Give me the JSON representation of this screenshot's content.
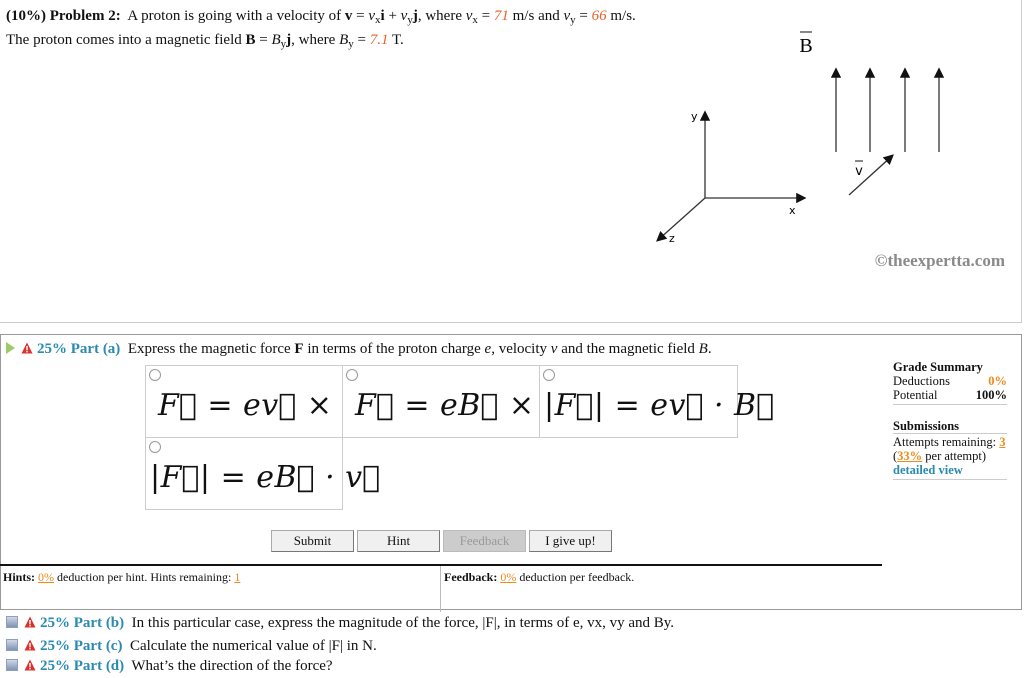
{
  "problem": {
    "weight": "(10%)",
    "title": "Problem 2:",
    "text_1": "A proton is going with a velocity of ",
    "v_bold": "v",
    "eq_1": " = ",
    "vx": "v",
    "x_sub": "x",
    "i": "i",
    "plus": " + ",
    "vy": "v",
    "y_sub": "y",
    "j": "j",
    "where_1": ", where ",
    "vx_val": "71",
    "units_1": " m/s and ",
    "vy_val": "66",
    "text_2": " m/s. The proton comes into a magnetic field ",
    "B_bold": "B",
    "By": "B",
    "where_2": ", where ",
    "By_val": "7.1",
    "units_2": " T."
  },
  "figure": {
    "B_label": "B",
    "v_label": "v",
    "axis_x": "x",
    "axis_y": "y",
    "axis_z": "z",
    "watermark": "©theexpertta.com"
  },
  "part_a": {
    "weight": "25%",
    "label": "Part (a)",
    "question_1": "Express the magnetic force ",
    "F": "F",
    "question_2": " in terms of the proton charge ",
    "e": "e",
    "question_3": ", velocity ",
    "v": "v",
    "question_4": " and the magnetic field ",
    "B": "B",
    "question_5": ".",
    "choices": [
      "F⃗ = ev⃗ × B⃗",
      "F⃗ = eB⃗ × v⃗",
      "|F⃗| = ev⃗ · B⃗",
      "|F⃗| = eB⃗ · v⃗"
    ]
  },
  "buttons": {
    "submit": "Submit",
    "hint": "Hint",
    "feedback": "Feedback",
    "give_up": "I give up!"
  },
  "grade_summary": {
    "title": "Grade Summary",
    "deductions_label": "Deductions",
    "deductions_value": "0%",
    "potential_label": "Potential",
    "potential_value": "100%",
    "submissions_title": "Submissions",
    "attempts_label": "Attempts remaining: ",
    "attempts_value": "3",
    "per_attempt_open": "(",
    "per_attempt_value": "33%",
    "per_attempt_text": " per attempt)",
    "detailed_view": "detailed view"
  },
  "hints": {
    "label": "Hints:",
    "pct": "0%",
    "text": " deduction per hint. Hints remaining: ",
    "remaining": "1"
  },
  "feedback": {
    "label": "Feedback:",
    "pct": "0%",
    "text": " deduction per feedback."
  },
  "other_parts": [
    {
      "weight": "25%",
      "label": "Part (b)",
      "question": "In this particular case, express the magnitude of the force, |F|, in terms of e, vx, vy and By."
    },
    {
      "weight": "25%",
      "label": "Part (c)",
      "question": "Calculate the numerical value of |F| in N."
    },
    {
      "weight": "25%",
      "label": "Part (d)",
      "question": "What’s the direction of the force?"
    }
  ]
}
